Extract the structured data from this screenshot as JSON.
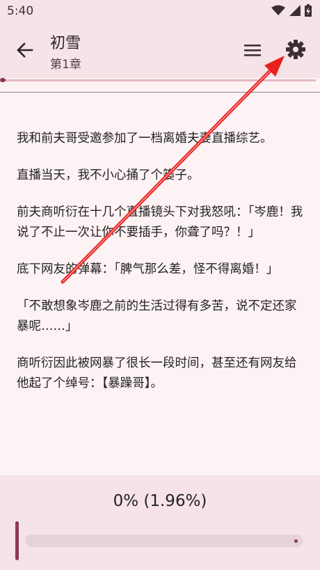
{
  "status_bar": {
    "time": "5:40",
    "icons": [
      "wifi-icon",
      "signal-icon",
      "battery-charging-icon"
    ]
  },
  "app_bar": {
    "back_icon": "arrow-back-icon",
    "title": "初雪",
    "subtitle": "第1章",
    "menu_icon": "menu-icon",
    "settings_icon": "gear-icon"
  },
  "reading_progress": 0.0196,
  "content": {
    "paragraphs": [
      "我和前夫哥受邀参加了一档离婚夫妻直播综艺。",
      "直播当天，我不小心捅了个篓子。",
      "前夫商听衍在十几个直播镜头下对我怒吼：「岑鹿！我说了不止一次让你不要插手，你聋了吗？！」",
      "底下网友的弹幕：「脾气那么差，怪不得离婚！」",
      "「不敢想象岑鹿之前的生活过得有多苦，说不定还家暴呢……」",
      "商听衍因此被网暴了很长一段时间，甚至还有网友给他起了个绰号：【暴躁哥】。"
    ]
  },
  "bottom_panel": {
    "percent_label": "0% (1.96%)",
    "slider_value": 0
  },
  "colors": {
    "accent": "#8b3a55",
    "annotation_arrow": "#e8201f",
    "background": "#fdf2f4",
    "bar": "#f6e3e7"
  }
}
